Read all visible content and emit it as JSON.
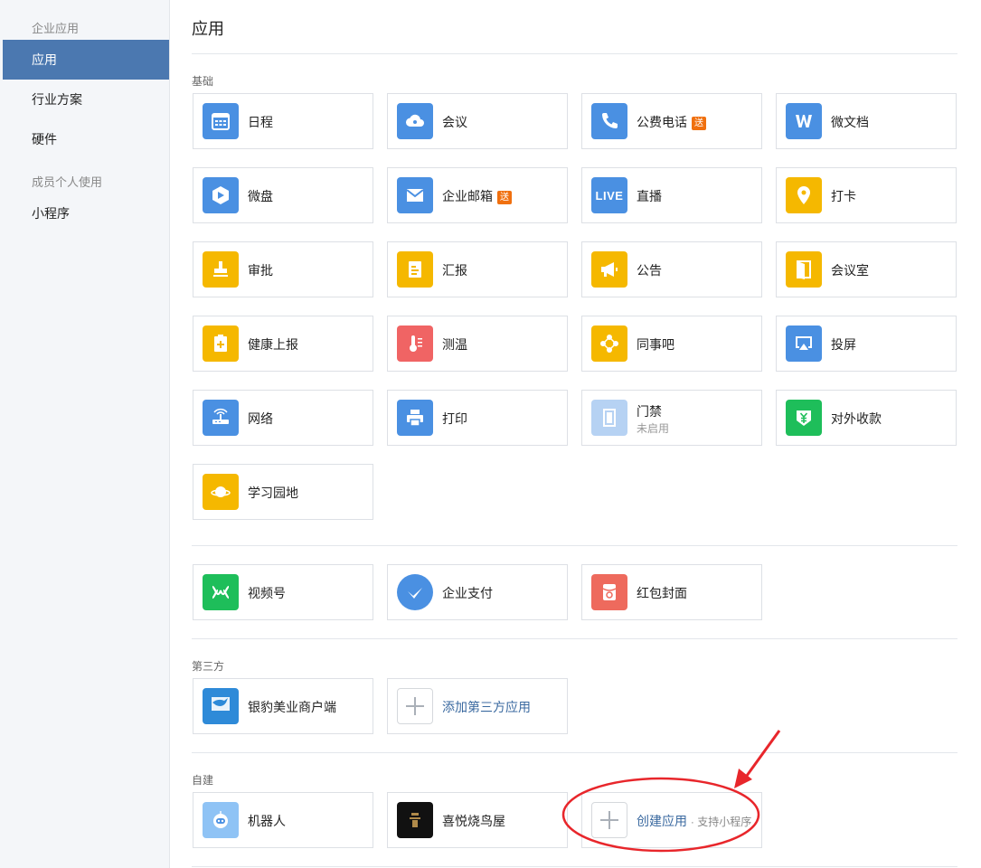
{
  "sidebar": {
    "group1": "企业应用",
    "items": [
      {
        "label": "应用"
      },
      {
        "label": "行业方案"
      },
      {
        "label": "硬件"
      }
    ],
    "group2": "成员个人使用",
    "mini": "小程序"
  },
  "page_title": "应用",
  "sections": {
    "basic": "基础",
    "third": "第三方",
    "custom": "自建"
  },
  "apps": {
    "schedule": "日程",
    "meeting": "会议",
    "phone": "公费电话",
    "doc": "微文档",
    "disk": "微盘",
    "mail": "企业邮箱",
    "live": "直播",
    "checkin": "打卡",
    "approval": "审批",
    "report": "汇报",
    "notice": "公告",
    "room": "会议室",
    "health": "健康上报",
    "temp": "测温",
    "bar": "同事吧",
    "cast": "投屏",
    "network": "网络",
    "print": "打印",
    "door": "门禁",
    "door_status": "未启用",
    "pay_ext": "对外收款",
    "study": "学习园地",
    "channels": "视频号",
    "wepay": "企业支付",
    "redpacket": "红包封面",
    "yinbao": "银豹美业商户端",
    "add_third": "添加第三方应用",
    "robot": "机器人",
    "xiyue": "喜悦烧鸟屋",
    "create_app": "创建应用",
    "create_sub": "· 支持小程序"
  },
  "badge": "送",
  "live_icon_text": "LIVE",
  "colors": {
    "active": "#4b78b0",
    "blue": "#4a90e2",
    "yellow": "#f5b800",
    "red": "#f06464",
    "green": "#1ebe5a",
    "badge": "#f0700f",
    "annotation": "#e8262b"
  },
  "icons": [
    "calendar-icon",
    "cloud-icon",
    "phone-icon",
    "w-doc-icon",
    "disk-icon",
    "mail-icon",
    "live-icon",
    "location-pin-icon",
    "stamp-icon",
    "report-icon",
    "megaphone-icon",
    "door-icon",
    "health-icon",
    "thermometer-icon",
    "team-icon",
    "cast-icon",
    "router-icon",
    "printer-icon",
    "gate-icon",
    "yen-icon",
    "planet-icon",
    "channels-icon",
    "wepay-icon",
    "redpacket-icon",
    "leopard-icon",
    "plus-icon",
    "robot-icon",
    "shop-logo-icon"
  ]
}
